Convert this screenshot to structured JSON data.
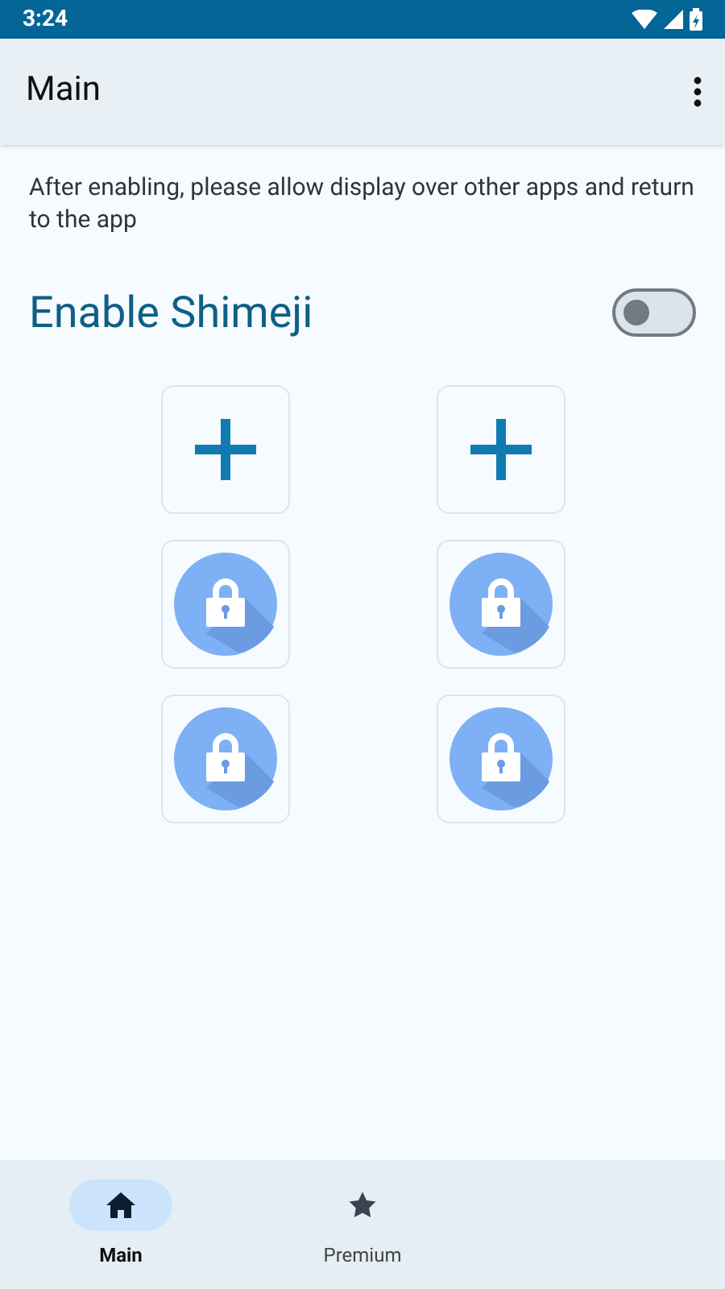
{
  "status_bar": {
    "time": "3:24"
  },
  "app_bar": {
    "title": "Main"
  },
  "hint": "After enabling, please allow display over other apps and return to the app",
  "enable": {
    "label": "Enable Shimeji",
    "on": false
  },
  "slots": [
    {
      "kind": "add"
    },
    {
      "kind": "add"
    },
    {
      "kind": "locked"
    },
    {
      "kind": "locked"
    },
    {
      "kind": "locked"
    },
    {
      "kind": "locked"
    }
  ],
  "nav": [
    {
      "label": "Main",
      "kind": "home",
      "selected": true
    },
    {
      "label": "Premium",
      "kind": "star",
      "selected": false
    }
  ]
}
